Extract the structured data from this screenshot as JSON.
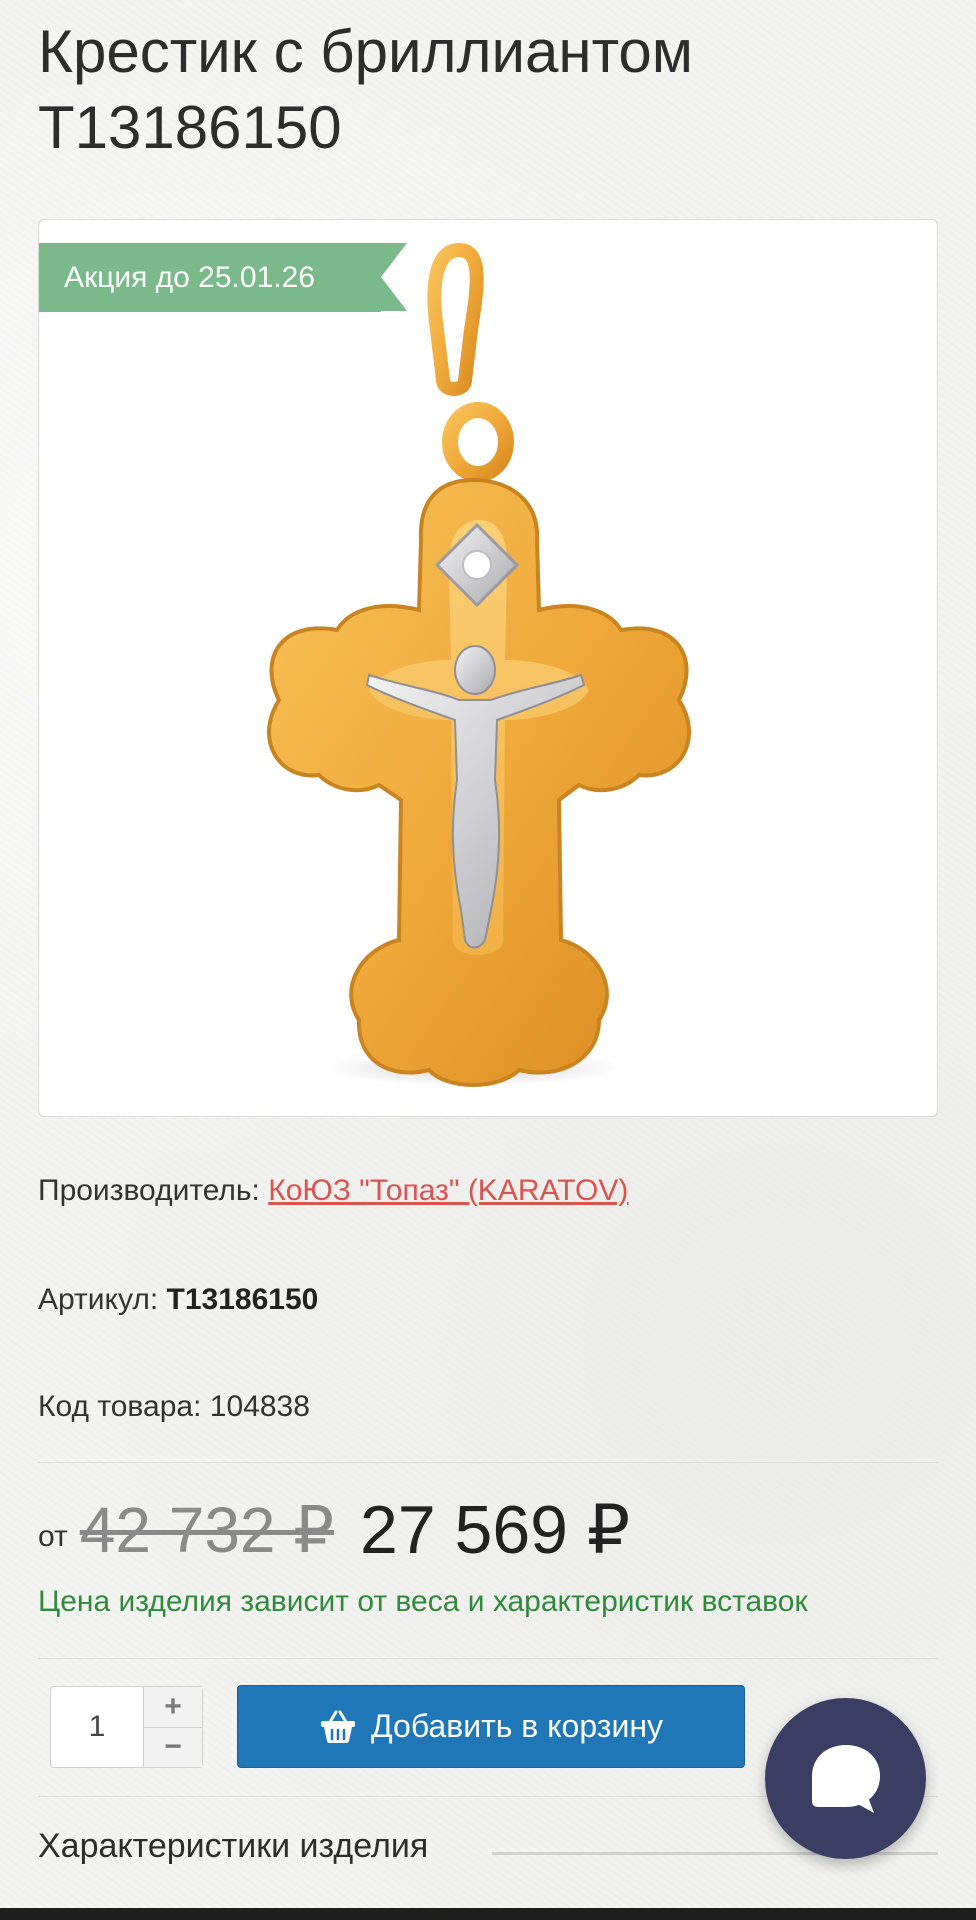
{
  "product": {
    "title": "Крестик с бриллиантом Т13186150",
    "promo_label": "Акция до 25.01.26",
    "image_alt": "Крестик с бриллиантом"
  },
  "details": {
    "manufacturer_label": "Производитель:",
    "manufacturer_name": "КоЮЗ \"Топаз\" (KARATOV)",
    "sku_label": "Артикул:",
    "sku_value": "Т13186150",
    "code_label": "Код товара:",
    "code_value": "104838"
  },
  "price": {
    "from_label": "от",
    "old_price": "42 732 ₽",
    "new_price": "27 569 ₽",
    "note": "Цена изделия зависит от веса и характеристик вставок"
  },
  "cart": {
    "quantity": "1",
    "plus_label": "+",
    "minus_label": "−",
    "add_button_label": "Добавить в корзину"
  },
  "section": {
    "title": "Характеристики изделия"
  },
  "colors": {
    "promo_green": "#7ab98a",
    "link_red": "#d9534f",
    "note_green": "#2e8b3a",
    "button_blue": "#1f77b8",
    "chat_bg": "#3b3e63"
  },
  "icons": {
    "cart": "basket-icon",
    "chat": "chat-bubble-icon"
  }
}
